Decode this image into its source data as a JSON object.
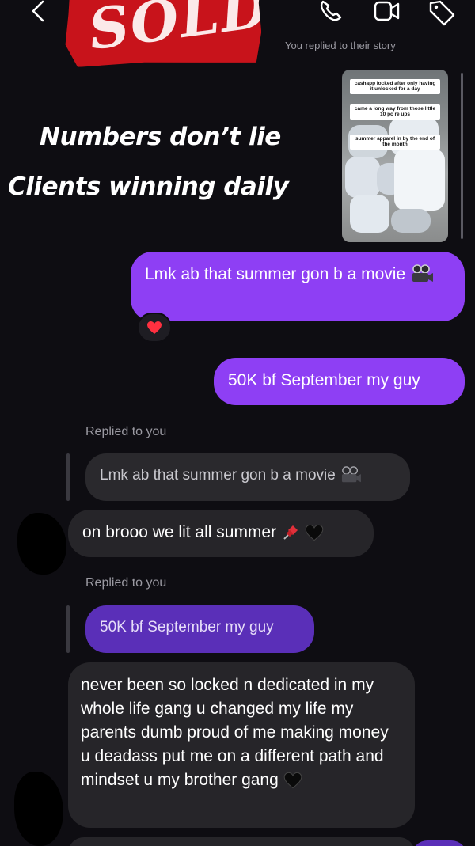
{
  "header": {
    "sold_text": "SOLD",
    "story_reply_note": "You replied to their story",
    "icons": [
      "back-icon",
      "phone-icon",
      "video-icon",
      "tag-icon"
    ]
  },
  "overlay": {
    "line1": "Numbers don’t lie",
    "line2": "Clients winning daily"
  },
  "story": {
    "captions": [
      "cashapp locked after only having it unlocked for a day",
      "came a long way from those little 10 pc re ups",
      "summer apparel in by the end of the month"
    ]
  },
  "messages": {
    "sent1": "Lmk ab that summer gon b a movie",
    "sent1_reaction": "heart",
    "sent2": "50K bf September my guy",
    "replied_label_1": "Replied to you",
    "quote1": "Lmk ab that summer gon b a movie",
    "received1": "on brooo we lit all summer",
    "replied_label_2": "Replied to you",
    "quote2": "50K bf September my guy",
    "received2": "never been so locked n dedicated in my whole life gang u changed my life my parents dumb proud of me making money u deadass put me on a different path and mindset u my brother gang"
  },
  "colors": {
    "background": "#0e0d12",
    "sent_bubble": "#8e3ff4",
    "received_bubble": "#262529",
    "quote_purple": "#5a2fb8",
    "sticker_red": "#c8131b"
  }
}
